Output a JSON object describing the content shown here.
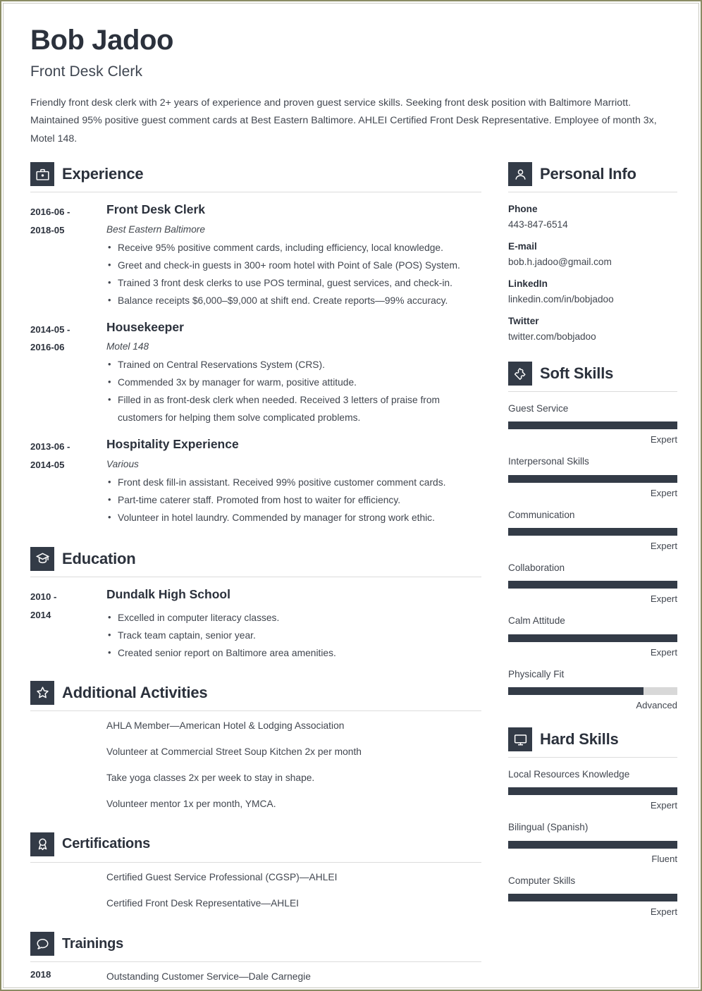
{
  "header": {
    "name": "Bob Jadoo",
    "job_title": "Front Desk Clerk",
    "summary": "Friendly front desk clerk with 2+ years of experience and proven guest service skills. Seeking front desk position with Baltimore Marriott. Maintained 95% positive guest comment cards at Best Eastern Baltimore. AHLEI Certified Front Desk Representative. Employee of month 3x, Motel 148."
  },
  "theme": {
    "dark": "#333b47",
    "track": "#d8d8d8",
    "text": "#41464f",
    "border": "#8a8b63"
  },
  "sections": {
    "experience": {
      "title": "Experience",
      "icon": "briefcase-icon",
      "entries": [
        {
          "date_from": "2016-06 -",
          "date_to": "2018-05",
          "title": "Front Desk Clerk",
          "employer": "Best Eastern Baltimore",
          "bullets": [
            "Receive 95% positive comment cards, including efficiency, local knowledge.",
            "Greet and check-in guests in 300+ room hotel with Point of Sale (POS) System.",
            "Trained 3 front desk clerks to use POS terminal, guest services, and check-in.",
            "Balance receipts $6,000–$9,000 at shift end. Create reports—99% accuracy."
          ]
        },
        {
          "date_from": "2014-05 -",
          "date_to": "2016-06",
          "title": "Housekeeper",
          "employer": "Motel 148",
          "bullets": [
            "Trained on Central Reservations System (CRS).",
            "Commended 3x by manager for warm, positive attitude.",
            "Filled in as front-desk clerk when needed. Received 3 letters of praise from customers for helping them solve complicated problems."
          ]
        },
        {
          "date_from": "2013-06 -",
          "date_to": "2014-05",
          "title": "Hospitality Experience",
          "employer": "Various",
          "bullets": [
            "Front desk fill-in assistant. Received 99% positive customer comment cards.",
            "Part-time caterer staff. Promoted from host to waiter for efficiency.",
            "Volunteer in hotel laundry. Commended by manager for strong work ethic."
          ]
        }
      ]
    },
    "education": {
      "title": "Education",
      "icon": "graduation-cap-icon",
      "entries": [
        {
          "date_from": "2010 -",
          "date_to": "2014",
          "title": "Dundalk High School",
          "employer": "",
          "bullets": [
            "Excelled in computer literacy classes.",
            "Track team captain, senior year.",
            "Created senior report on Baltimore area amenities."
          ]
        }
      ]
    },
    "additional_activities": {
      "title": "Additional Activities",
      "icon": "star-icon",
      "items": [
        "AHLA Member—American Hotel & Lodging Association",
        "Volunteer at Commercial Street Soup Kitchen 2x per month",
        "Take yoga classes 2x per week to stay in shape.",
        "Volunteer mentor 1x per month, YMCA."
      ]
    },
    "certifications": {
      "title": "Certifications",
      "icon": "award-ribbon-icon",
      "items": [
        "Certified Guest Service Professional (CGSP)—AHLEI",
        "Certified Front Desk Representative—AHLEI"
      ]
    },
    "trainings": {
      "title": "Trainings",
      "icon": "speech-bubble-icon",
      "items": [
        {
          "date": "2018",
          "text": "Outstanding Customer Service—Dale Carnegie"
        }
      ]
    },
    "personal_info": {
      "title": "Personal Info",
      "icon": "person-icon",
      "fields": [
        {
          "label": "Phone",
          "value": "443-847-6514"
        },
        {
          "label": "E-mail",
          "value": "bob.h.jadoo@gmail.com"
        },
        {
          "label": "LinkedIn",
          "value": "linkedin.com/in/bobjadoo"
        },
        {
          "label": "Twitter",
          "value": "twitter.com/bobjadoo"
        }
      ]
    },
    "soft_skills": {
      "title": "Soft Skills",
      "icon": "puzzle-piece-icon",
      "skills": [
        {
          "name": "Guest Service",
          "level": "Expert",
          "percent": 100
        },
        {
          "name": "Interpersonal Skills",
          "level": "Expert",
          "percent": 100
        },
        {
          "name": "Communication",
          "level": "Expert",
          "percent": 100
        },
        {
          "name": "Collaboration",
          "level": "Expert",
          "percent": 100
        },
        {
          "name": "Calm Attitude",
          "level": "Expert",
          "percent": 100
        },
        {
          "name": "Physically Fit",
          "level": "Advanced",
          "percent": 80
        }
      ]
    },
    "hard_skills": {
      "title": "Hard Skills",
      "icon": "monitor-icon",
      "skills": [
        {
          "name": "Local Resources Knowledge",
          "level": "Expert",
          "percent": 100
        },
        {
          "name": "Bilingual (Spanish)",
          "level": "Fluent",
          "percent": 100
        },
        {
          "name": "Computer Skills",
          "level": "Expert",
          "percent": 100
        }
      ]
    }
  }
}
